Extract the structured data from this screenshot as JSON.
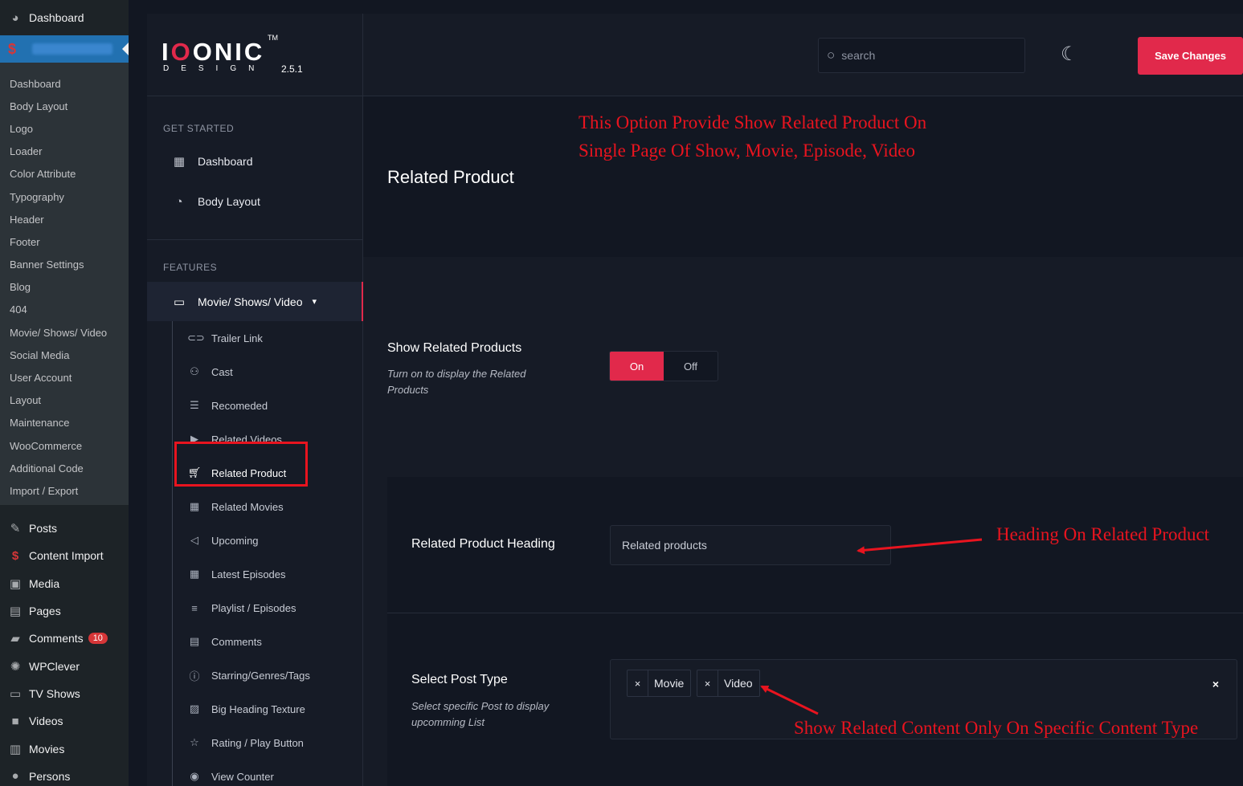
{
  "wp_menu": {
    "dashboard_label": "Dashboard",
    "submenu": [
      "Dashboard",
      "Body Layout",
      "Logo",
      "Loader",
      "Color Attribute",
      "Typography",
      "Header",
      "Footer",
      "Banner Settings",
      "Blog",
      "404",
      "Movie/ Shows/ Video",
      "Social Media",
      "User Account",
      "Layout",
      "Maintenance",
      "WooCommerce",
      "Additional Code",
      "Import / Export"
    ],
    "lower": [
      {
        "label": "Posts",
        "icon": "pin-icon"
      },
      {
        "label": "Content Import",
        "icon": "dollar-icon"
      },
      {
        "label": "Media",
        "icon": "media-icon"
      },
      {
        "label": "Pages",
        "icon": "pages-icon"
      },
      {
        "label": "Comments",
        "icon": "comment-icon",
        "badge": "10"
      },
      {
        "label": "WPClever",
        "icon": "bulb-icon"
      },
      {
        "label": "TV Shows",
        "icon": "tv-icon"
      },
      {
        "label": "Videos",
        "icon": "video-icon"
      },
      {
        "label": "Movies",
        "icon": "film-icon"
      },
      {
        "label": "Persons",
        "icon": "person-icon"
      }
    ]
  },
  "logo": {
    "brand_pre": "I",
    "brand_dot1": "O",
    "brand_mid": "O",
    "brand_post": "NIC",
    "tm": "TM",
    "sub": "DESIGN",
    "version": "2.5.1"
  },
  "nav": {
    "get_started": "GET STARTED",
    "get_started_items": [
      {
        "label": "Dashboard",
        "icon": "grid-icon"
      },
      {
        "label": "Body Layout",
        "icon": "gauge-icon"
      }
    ],
    "features": "FEATURES",
    "group_label": "Movie/ Shows/ Video",
    "sub_items": [
      {
        "label": "Trailer Link",
        "icon": "link-icon"
      },
      {
        "label": "Cast",
        "icon": "people-icon"
      },
      {
        "label": "Recomeded",
        "icon": "card-icon"
      },
      {
        "label": "Related Videos",
        "icon": "play-icon"
      },
      {
        "label": "Related Product",
        "icon": "cart-icon"
      },
      {
        "label": "Related Movies",
        "icon": "calendar-icon"
      },
      {
        "label": "Upcoming",
        "icon": "megaphone-icon"
      },
      {
        "label": "Latest Episodes",
        "icon": "calendar-icon"
      },
      {
        "label": "Playlist / Episodes",
        "icon": "list-check-icon"
      },
      {
        "label": "Comments",
        "icon": "comment-box-icon"
      },
      {
        "label": "Starring/Genres/Tags",
        "icon": "info-icon"
      },
      {
        "label": "Big Heading Texture",
        "icon": "hatch-icon"
      },
      {
        "label": "Rating / Play Button",
        "icon": "star-icon"
      },
      {
        "label": "View Counter",
        "icon": "eye-icon"
      }
    ]
  },
  "topbar": {
    "search_placeholder": "search",
    "save_label": "Save Changes"
  },
  "main": {
    "title": "Related Product",
    "show_related": {
      "label": "Show Related Products",
      "desc_1": "Turn on to display the Related",
      "desc_2": "Products",
      "on": "On",
      "off": "Off",
      "value": "On"
    },
    "heading": {
      "label": "Related Product Heading",
      "value": "Related products"
    },
    "post_type": {
      "label": "Select Post Type",
      "desc_1": "Select specific Post to display",
      "desc_2": "upcomming List",
      "tags": [
        "Movie",
        "Video"
      ],
      "tag_remove": "×",
      "clear": "×"
    }
  },
  "annotations": {
    "top_line_1": "This Option Provide Show Related Product On",
    "top_line_2": "Single Page Of Show, Movie, Episode, Video",
    "heading_note": "Heading On Related Product",
    "type_note": "Show Related Content Only On Specific Content Type",
    "color": "#e8141f"
  },
  "colors": {
    "accent": "#e1294b",
    "wp_active": "#2271b1",
    "bg": "#121722",
    "panel": "#161b26"
  }
}
